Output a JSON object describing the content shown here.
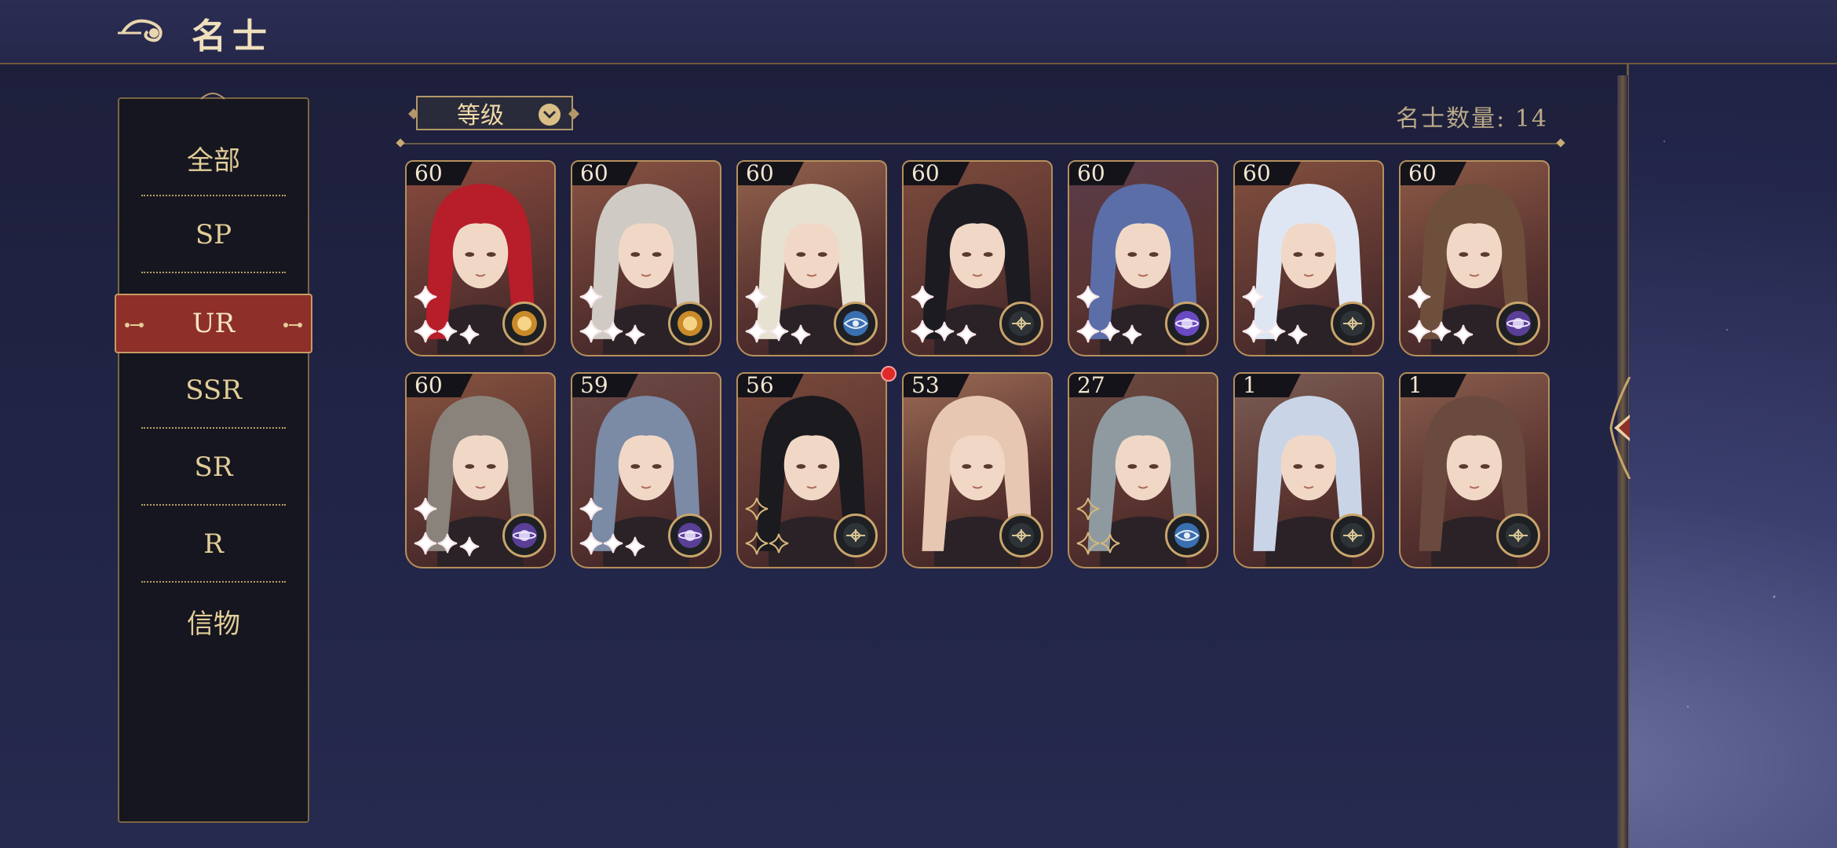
{
  "header": {
    "title": "名士"
  },
  "sidebar": {
    "items": [
      {
        "label": "全部",
        "active": false
      },
      {
        "label": "SP",
        "active": false
      },
      {
        "label": "UR",
        "active": true
      },
      {
        "label": "SSR",
        "active": false
      },
      {
        "label": "SR",
        "active": false
      },
      {
        "label": "R",
        "active": false
      },
      {
        "label": "信物",
        "active": false
      }
    ]
  },
  "toolbar": {
    "sort_label": "等级",
    "count_label": "名士数量: 14"
  },
  "cards": [
    {
      "level": "60",
      "hair": "#b81d2a",
      "bg": "#8a4b3e",
      "icon": "sun-orb-icon",
      "icon_color": "#c98a2a",
      "stars": 4,
      "star_color": "white",
      "new": false
    },
    {
      "level": "60",
      "hair": "#cfcac4",
      "bg": "#8a5444",
      "icon": "sun-orb-icon",
      "icon_color": "#c98a2a",
      "stars": 4,
      "star_color": "white",
      "new": false
    },
    {
      "level": "60",
      "hair": "#e7e1d2",
      "bg": "#93624d",
      "icon": "eye-emblem-icon",
      "icon_color": "#3a6fb0",
      "stars": 4,
      "star_color": "white",
      "new": false
    },
    {
      "level": "60",
      "hair": "#1d1b22",
      "bg": "#7d4b3c",
      "icon": "compass-emblem-icon",
      "icon_color": "#2e3338",
      "stars": 4,
      "star_color": "white",
      "new": false
    },
    {
      "level": "60",
      "hair": "#5b6ea8",
      "bg": "#5a3c4a",
      "icon": "planet-orb-icon",
      "icon_color": "#6a4ac2",
      "stars": 4,
      "star_color": "white",
      "new": false
    },
    {
      "level": "60",
      "hair": "#dfe6f3",
      "bg": "#83503f",
      "icon": "compass-emblem-icon",
      "icon_color": "#2e3338",
      "stars": 4,
      "star_color": "white",
      "new": false
    },
    {
      "level": "60",
      "hair": "#6e4f3c",
      "bg": "#8c5a46",
      "icon": "planet-orb-icon",
      "icon_color": "#5a3f96",
      "stars": 4,
      "star_color": "white",
      "new": false
    },
    {
      "level": "60",
      "hair": "#8a837b",
      "bg": "#87533f",
      "icon": "planet-orb-icon",
      "icon_color": "#5a3f96",
      "stars": 4,
      "star_color": "white",
      "new": false
    },
    {
      "level": "59",
      "hair": "#7b8aa5",
      "bg": "#6d4a47",
      "icon": "planet-orb-icon",
      "icon_color": "#5a3f96",
      "stars": 4,
      "star_color": "white",
      "new": false
    },
    {
      "level": "56",
      "hair": "#1a1a1f",
      "bg": "#7a4a3b",
      "icon": "compass-emblem-icon",
      "icon_color": "#2e3338",
      "stars": 3,
      "star_color": "gold",
      "new": true
    },
    {
      "level": "53",
      "hair": "#e7c7b2",
      "bg": "#9b6b55",
      "icon": "compass-emblem-icon",
      "icon_color": "#2e3338",
      "stars": 0,
      "star_color": "gold",
      "new": false
    },
    {
      "level": "27",
      "hair": "#8f9aa0",
      "bg": "#6b4a40",
      "icon": "eye-emblem-icon",
      "icon_color": "#3a6fb0",
      "stars": 3,
      "star_color": "gold",
      "new": false
    },
    {
      "level": "1",
      "hair": "#c9d5e6",
      "bg": "#7b5e55",
      "icon": "compass-emblem-icon",
      "icon_color": "#2e3338",
      "stars": 0,
      "star_color": "gold",
      "new": false
    },
    {
      "level": "1",
      "hair": "#6a4a3e",
      "bg": "#8a5e4e",
      "icon": "compass-emblem-icon",
      "icon_color": "#2e3338",
      "stars": 0,
      "star_color": "gold",
      "new": false
    }
  ]
}
